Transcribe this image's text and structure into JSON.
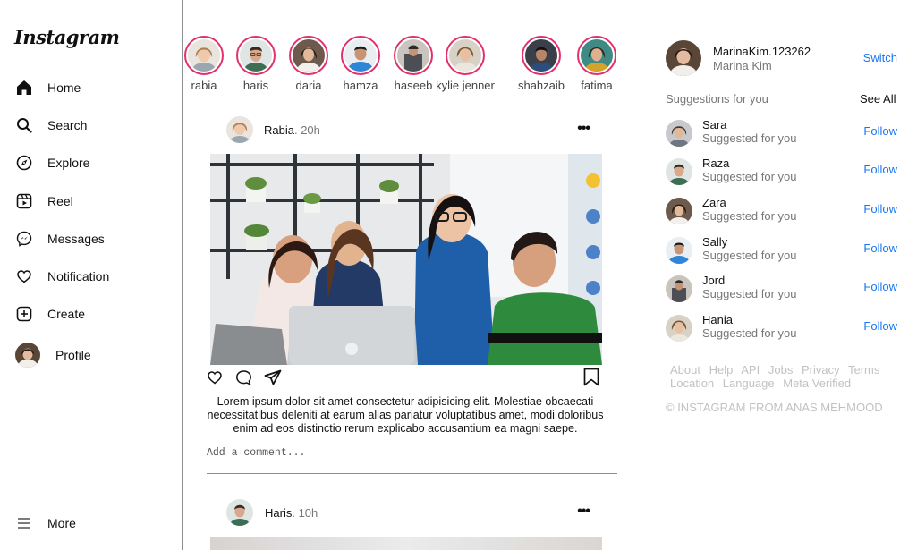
{
  "app": {
    "logo": "Instagram"
  },
  "sidebar": {
    "items": [
      {
        "label": "Home",
        "icon": "home-icon"
      },
      {
        "label": "Search",
        "icon": "search-icon"
      },
      {
        "label": "Explore",
        "icon": "compass-icon"
      },
      {
        "label": "Reel",
        "icon": "reel-icon"
      },
      {
        "label": "Messages",
        "icon": "messenger-icon"
      },
      {
        "label": "Notification",
        "icon": "heart-icon"
      },
      {
        "label": "Create",
        "icon": "plus-square-icon"
      },
      {
        "label": "Profile",
        "icon": "avatar"
      }
    ],
    "more": {
      "label": "More",
      "icon": "hamburger-icon"
    }
  },
  "stories": [
    {
      "name": "rabia"
    },
    {
      "name": "haris"
    },
    {
      "name": "daria"
    },
    {
      "name": "hamza"
    },
    {
      "name": "haseeb"
    },
    {
      "name": "kylie jenner"
    },
    {
      "name": "shahzaib"
    },
    {
      "name": "fatima"
    }
  ],
  "posts": [
    {
      "user": "Rabia",
      "time": ". 20h",
      "more": "•••",
      "caption": "Lorem ipsum dolor sit amet consectetur adipisicing elit. Molestiae obcaecati necessitatibus deleniti at earum alias pariatur voluptatibus amet, modi doloribus enim ad eos distinctio rerum explicabo accusantium ea magni saepe.",
      "comment_placeholder": "Add a comment..."
    },
    {
      "user": "Haris",
      "time": ". 10h",
      "more": "•••"
    }
  ],
  "me": {
    "username": "MarinaKim.123262",
    "fullname": "Marina Kim",
    "switch": "Switch"
  },
  "suggestions": {
    "title": "Suggestions for you",
    "see_all": "See All",
    "items": [
      {
        "name": "Sara",
        "sub": "Suggested for you",
        "action": "Follow"
      },
      {
        "name": "Raza",
        "sub": "Suggested for you",
        "action": "Follow"
      },
      {
        "name": "Zara",
        "sub": "Suggested for you",
        "action": "Follow"
      },
      {
        "name": "Sally",
        "sub": "Suggested for you",
        "action": "Follow"
      },
      {
        "name": "Jord",
        "sub": "Suggested for you",
        "action": "Follow"
      },
      {
        "name": "Hania",
        "sub": "Suggested for you",
        "action": "Follow"
      }
    ]
  },
  "footer": {
    "links": [
      "About",
      "Help",
      "API",
      "Jobs",
      "Privacy",
      "Terms",
      "Location",
      "Language",
      "Meta Verified"
    ],
    "copyright": "© INSTAGRAM FROM ANAS MEHMOOD"
  },
  "colors": {
    "story_ring": "#e1306c",
    "link_blue": "#1877f2",
    "muted": "#777777",
    "footer": "#c2c2c2"
  }
}
